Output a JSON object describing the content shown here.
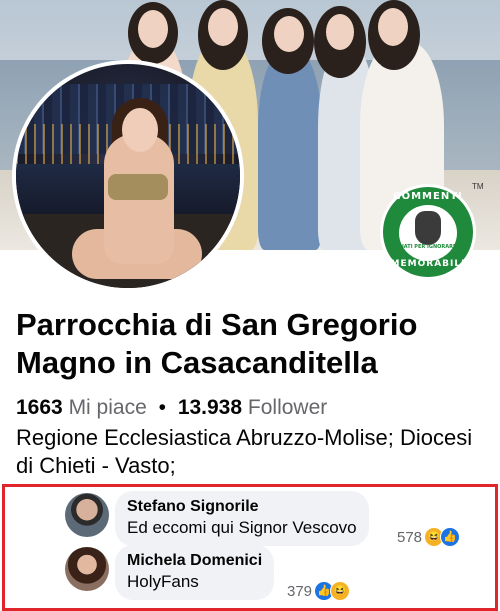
{
  "page": {
    "name": "Parrocchia di San Gregorio Magno in Casacanditella",
    "likes_count": "1663",
    "likes_label": "Mi piace",
    "separator": "•",
    "followers_count": "13.938",
    "followers_label": "Follower",
    "description": "Regione Ecclesiastica Abruzzo-Molise; Diocesi di Chieti - Vasto;"
  },
  "badge": {
    "top_text": "COMMENTI",
    "bottom_text": "MEMORABILI",
    "small_text": "NATI PER IGNORARE",
    "tm": "TM",
    "color": "#1f8a3c"
  },
  "comments": [
    {
      "author": "Stefano Signorile",
      "text": "Ed eccomi qui Signor Vescovo",
      "reaction_count": "578",
      "reactions": [
        "haha-icon",
        "like-icon"
      ]
    },
    {
      "author": "Michela Domenici",
      "text": "HolyFans",
      "reaction_count": "379",
      "reactions": [
        "like-icon",
        "haha-icon"
      ]
    }
  ],
  "colors": {
    "highlight_border": "#e0262b",
    "bubble": "#f0f2f5",
    "muted_text": "#65676b",
    "like_blue": "#1b74e4",
    "haha_yellow": "#f7b125"
  }
}
